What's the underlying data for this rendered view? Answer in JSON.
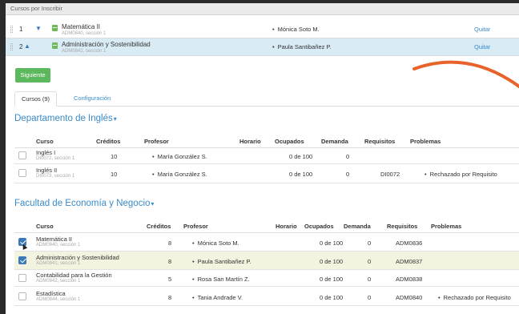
{
  "header": {
    "title": "Cursos por Inscribir"
  },
  "enrolled": [
    {
      "num": "1",
      "arrow": "▼",
      "name": "Matemática II",
      "code": "ADM0840, sección 1",
      "professor": "Mónica Soto M.",
      "action": "Quitar"
    },
    {
      "num": "2",
      "arrow": "▲",
      "name": "Administración y Sostenibilidad",
      "code": "ADM0841, sección 1",
      "professor": "Paula Santibañez P.",
      "action": "Quitar"
    }
  ],
  "next_button": "Siguiente",
  "tabs": [
    {
      "label": "Cursos (9)"
    },
    {
      "label": "Configuración"
    }
  ],
  "columns": {
    "course": "Curso",
    "credits": "Créditos",
    "professor": "Profesor",
    "schedule": "Horario",
    "occupied": "Ocupados",
    "demand": "Demanda",
    "requirements": "Requisitos",
    "problems": "Problemas"
  },
  "departments": [
    {
      "title": "Departamento de Inglés",
      "courses": [
        {
          "name": "Inglés I",
          "code": "DI0072, sección 1",
          "credits": "10",
          "professor": "María González S.",
          "occupied": "0 de 100",
          "demand": "0",
          "requirements": "",
          "problem": "",
          "checked": false,
          "highlight": false
        },
        {
          "name": "Inglés II",
          "code": "DI0073, sección 1",
          "credits": "10",
          "professor": "María González S.",
          "occupied": "0 de 100",
          "demand": "0",
          "requirements": "DI0072",
          "problem": "Rechazado por Requisito",
          "checked": false,
          "highlight": false
        }
      ]
    },
    {
      "title": "Facultad de Economía y Negocio",
      "courses": [
        {
          "name": "Matemática II",
          "code": "ADM0840, sección 1",
          "credits": "8",
          "professor": "Mónica Soto M.",
          "occupied": "0 de 100",
          "demand": "0",
          "requirements": "ADM0836",
          "problem": "",
          "checked": true,
          "highlight": false
        },
        {
          "name": "Administración y Sostenibilidad",
          "code": "ADM0841, sección 1",
          "credits": "8",
          "professor": "Paula Santibañez P.",
          "occupied": "0 de 100",
          "demand": "0",
          "requirements": "ADM0837",
          "problem": "",
          "checked": true,
          "highlight": true
        },
        {
          "name": "Contabilidad para la Gestión",
          "code": "ADM0842, sección 1",
          "credits": "5",
          "professor": "Rosa San Martín Z.",
          "occupied": "0 de 100",
          "demand": "0",
          "requirements": "ADM0838",
          "problem": "",
          "checked": false,
          "highlight": false
        },
        {
          "name": "Estadística",
          "code": "ADM0844, sección 1",
          "credits": "8",
          "professor": "Tania Andrade V.",
          "occupied": "0 de 100",
          "demand": "0",
          "requirements": "ADM0840",
          "problem": "Rechazado por Requisito",
          "checked": false,
          "highlight": false
        }
      ]
    }
  ],
  "colors": {
    "accent": "#3a8bc9",
    "success": "#5cb85c",
    "annotation": "#e8632a",
    "selected_row": "#d9ebf5",
    "highlight_row": "#f4f3e0"
  },
  "icons": {
    "drag": "drag-handle-icon",
    "course": "book-icon",
    "dropdown": "caret-down-icon",
    "cursor": "mouse-cursor-icon"
  }
}
